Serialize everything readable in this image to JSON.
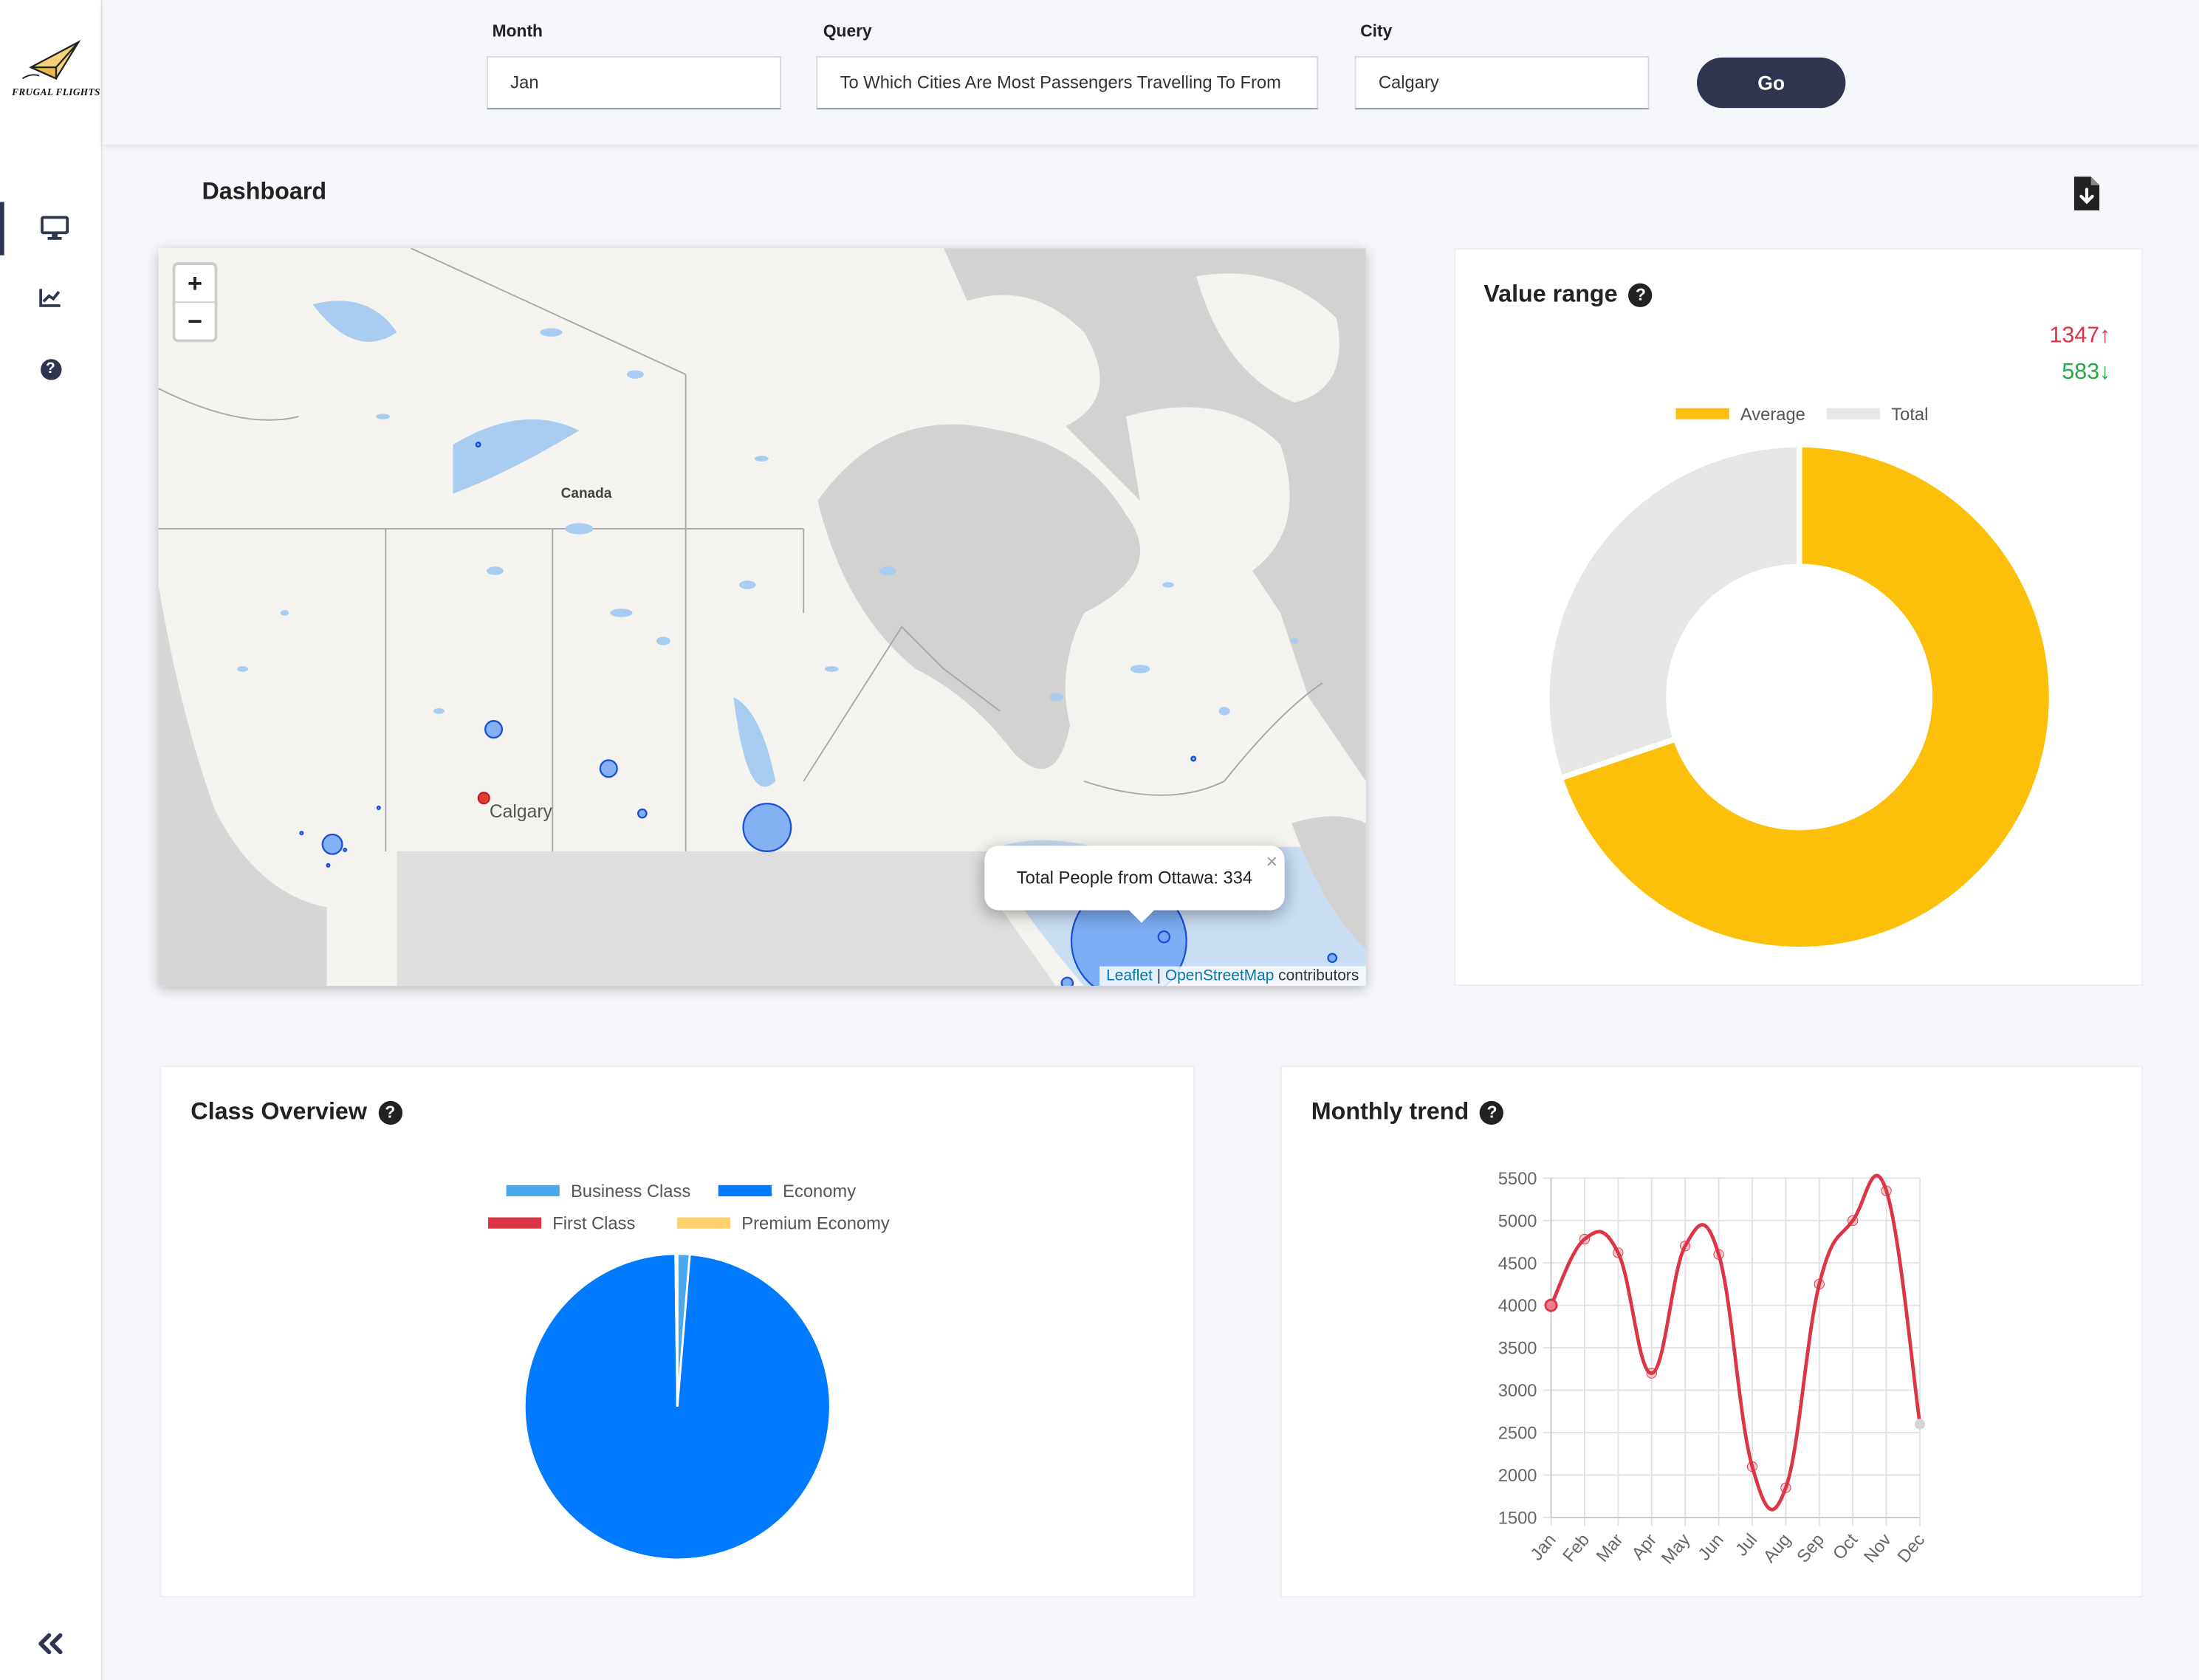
{
  "app": {
    "logo_text": "FRUGAL FLIGHTS"
  },
  "sidebar": {
    "items": [
      {
        "name": "dashboard",
        "icon": "monitor-icon",
        "active": true
      },
      {
        "name": "trends",
        "icon": "line-chart-icon",
        "active": false
      },
      {
        "name": "help",
        "icon": "help-icon",
        "active": false
      }
    ],
    "collapse_icon": "double-chevron-left-icon"
  },
  "filters": {
    "month_label": "Month",
    "month_value": "Jan",
    "query_label": "Query",
    "query_value": "To Which Cities Are Most Passengers Travelling To From",
    "city_label": "City",
    "city_value": "Calgary",
    "go_label": "Go"
  },
  "page": {
    "title": "Dashboard",
    "download_icon": "file-download-icon"
  },
  "map": {
    "region_label": "Canada",
    "selected_city": "Calgary",
    "popup_text": "Total People from Ottawa: 334",
    "attribution_leaflet": "Leaflet",
    "attribution_sep": " | ",
    "attribution_osm": "OpenStreetMap",
    "attribution_suffix": " contributors",
    "zoom_in": "+",
    "zoom_out": "−",
    "close_symbol": "×"
  },
  "value_range": {
    "title": "Value range",
    "max_value": "1347↑",
    "min_value": "583↓",
    "max_color": "#dc3545",
    "min_color": "#28a745"
  },
  "class_overview": {
    "title": "Class Overview"
  },
  "monthly_trend": {
    "title": "Monthly trend"
  },
  "chart_data": [
    {
      "type": "pie",
      "variant": "doughnut",
      "labels": [
        "Average",
        "Total"
      ],
      "values": [
        1347,
        583
      ],
      "colors": [
        "#fcbf0a",
        "#e6e6e6"
      ],
      "legend": "top"
    },
    {
      "type": "pie",
      "labels": [
        "Business Class",
        "Economy",
        "First Class",
        "Premium Economy"
      ],
      "values": [
        1.3,
        98.5,
        0.1,
        0.1
      ],
      "colors": [
        "#4aa8ec",
        "#007bff",
        "#dc3545",
        "#ffd06b"
      ],
      "legend": "top"
    },
    {
      "type": "line",
      "categories": [
        "Jan",
        "Feb",
        "Mar",
        "Apr",
        "May",
        "Jun",
        "Jul",
        "Aug",
        "Sep",
        "Oct",
        "Nov",
        "Dec"
      ],
      "series": [
        {
          "values": [
            4000,
            4780,
            4620,
            3200,
            4700,
            4600,
            2100,
            1850,
            4250,
            5000,
            5350,
            2600
          ],
          "color": "#dc3545"
        }
      ],
      "yticks": [
        5500,
        5000,
        4500,
        4000,
        3500,
        3000,
        2500,
        2000,
        1500
      ],
      "ylim": [
        1500,
        5500
      ],
      "grid": true
    }
  ]
}
